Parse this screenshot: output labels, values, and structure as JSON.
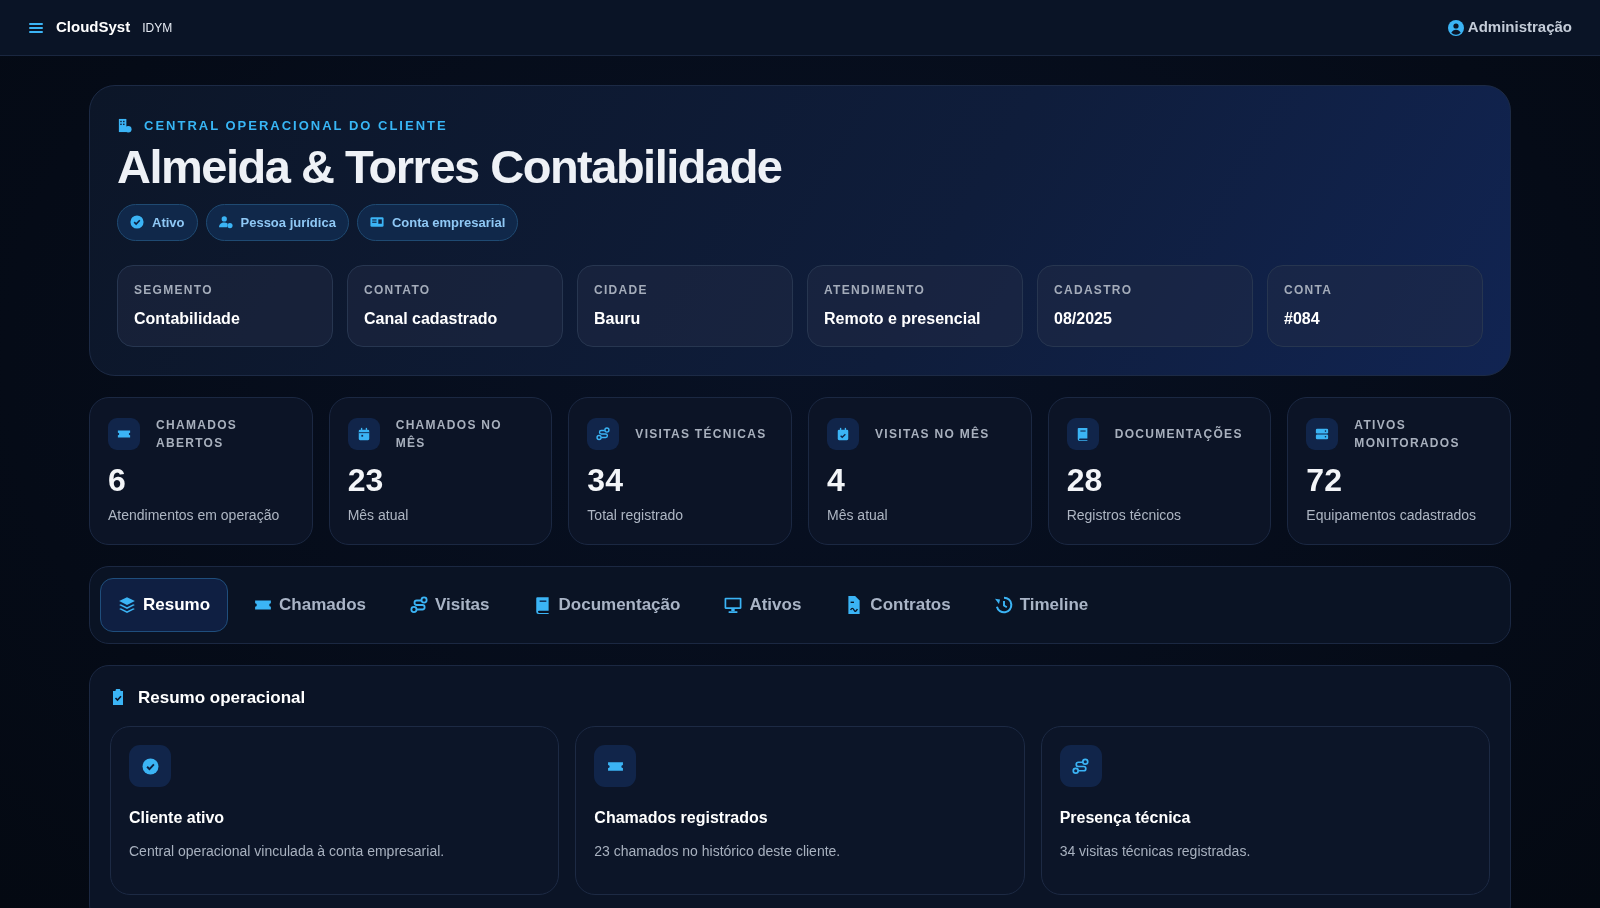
{
  "navbar": {
    "brand": "CloudSyst",
    "brand_tag": "IDYM",
    "user": "Administração"
  },
  "hero": {
    "eyebrow": "CENTRAL OPERACIONAL DO CLIENTE",
    "title": "Almeida & Torres Contabilidade",
    "badges": [
      "Ativo",
      "Pessoa jurídica",
      "Conta empresarial"
    ],
    "facts": [
      {
        "label": "SEGMENTO",
        "value": "Contabilidade"
      },
      {
        "label": "CONTATO",
        "value": "Canal cadastrado"
      },
      {
        "label": "CIDADE",
        "value": "Bauru"
      },
      {
        "label": "ATENDIMENTO",
        "value": "Remoto e presencial"
      },
      {
        "label": "CADASTRO",
        "value": "08/2025"
      },
      {
        "label": "CONTA",
        "value": "#084"
      }
    ]
  },
  "stats": [
    {
      "label": "CHAMADOS ABERTOS",
      "value": "6",
      "note": "Atendimentos em operação"
    },
    {
      "label": "CHAMADOS NO MÊS",
      "value": "23",
      "note": "Mês atual"
    },
    {
      "label": "VISITAS TÉCNICAS",
      "value": "34",
      "note": "Total registrado"
    },
    {
      "label": "VISITAS NO MÊS",
      "value": "4",
      "note": "Mês atual"
    },
    {
      "label": "DOCUMENTAÇÕES",
      "value": "28",
      "note": "Registros técnicos"
    },
    {
      "label": "ATIVOS MONITORADOS",
      "value": "72",
      "note": "Equipamentos cadastrados"
    }
  ],
  "tabs": [
    {
      "label": "Resumo",
      "selected": true
    },
    {
      "label": "Chamados",
      "selected": false
    },
    {
      "label": "Visitas",
      "selected": false
    },
    {
      "label": "Documentação",
      "selected": false
    },
    {
      "label": "Ativos",
      "selected": false
    },
    {
      "label": "Contratos",
      "selected": false
    },
    {
      "label": "Timeline",
      "selected": false
    }
  ],
  "summary": {
    "title": "Resumo operacional",
    "cards": [
      {
        "title": "Cliente ativo",
        "text": "Central operacional vinculada à conta empresarial."
      },
      {
        "title": "Chamados registrados",
        "text": "23 chamados no histórico deste cliente."
      },
      {
        "title": "Presença técnica",
        "text": "34 visitas técnicas registradas."
      }
    ]
  }
}
